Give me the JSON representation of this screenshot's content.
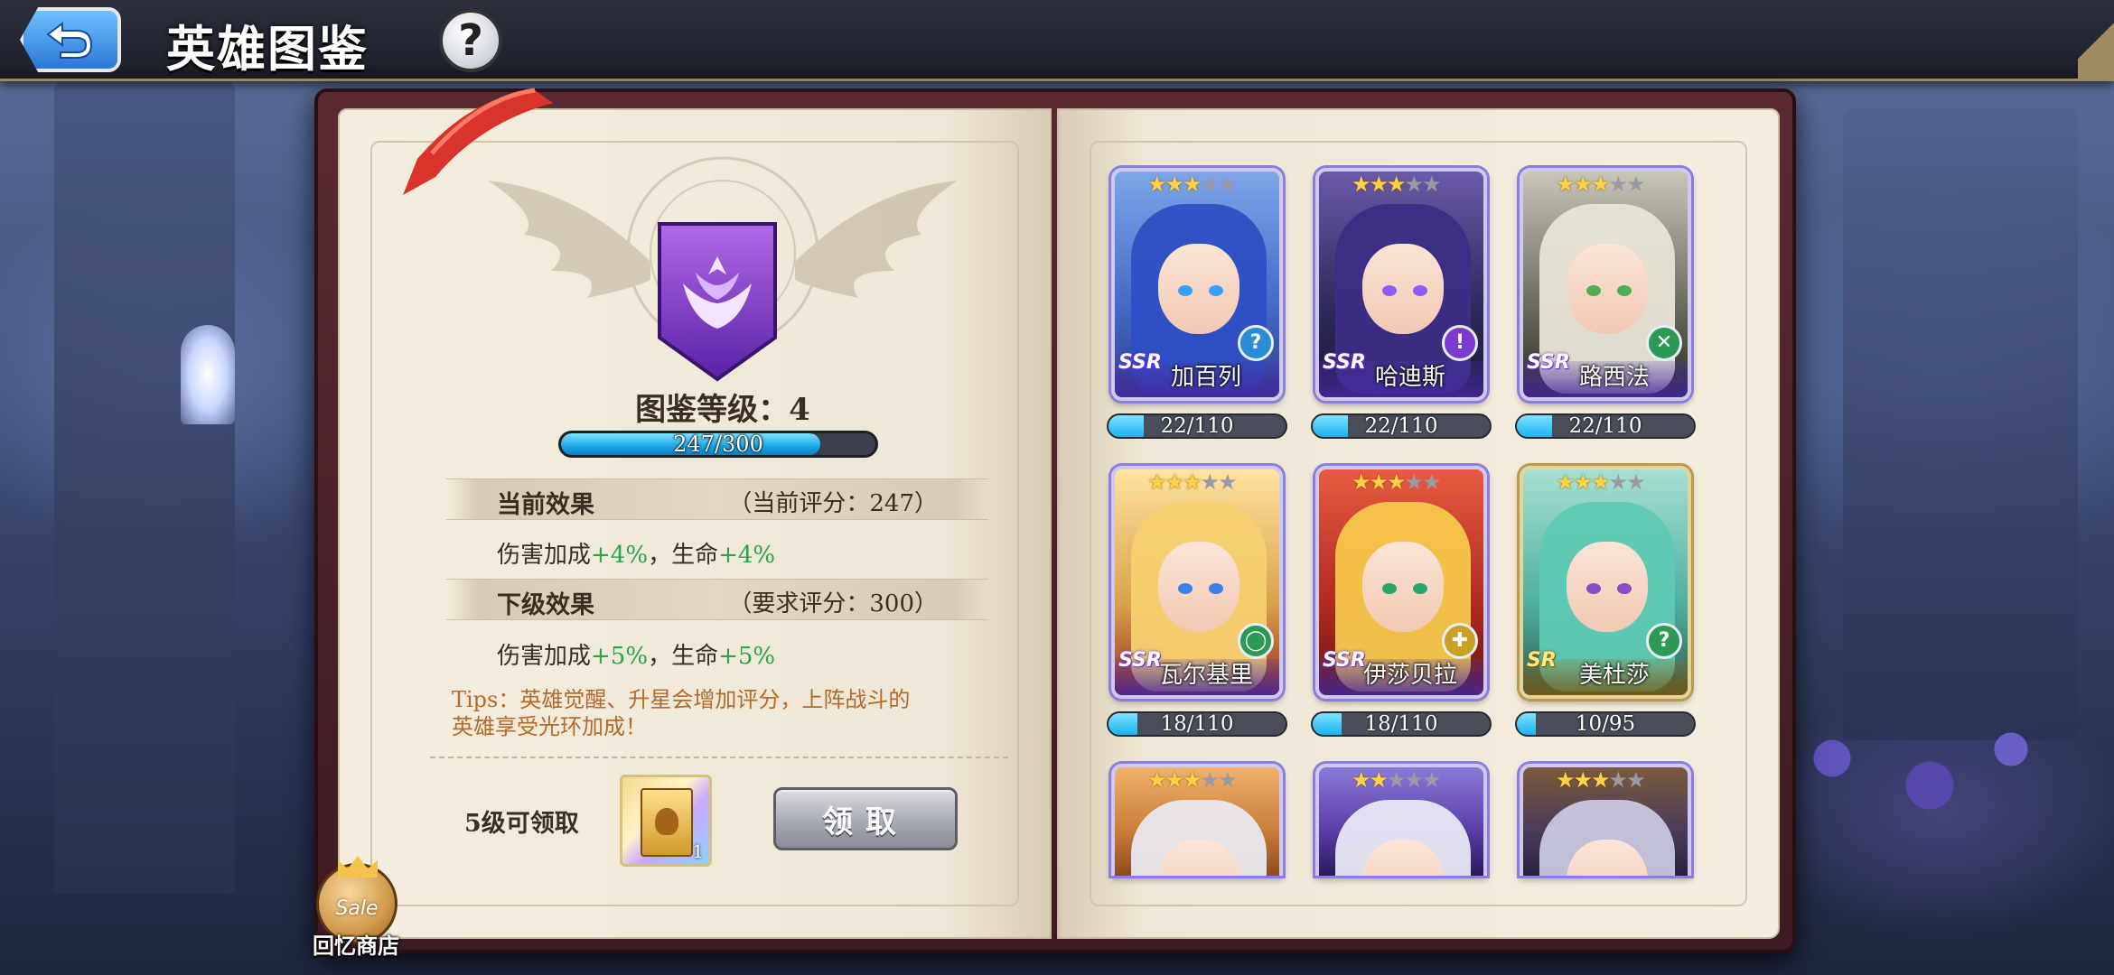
{
  "header": {
    "title": "英雄图鉴",
    "help_symbol": "?"
  },
  "collection": {
    "level_label": "图鉴等级：4",
    "exp_current": 247,
    "exp_max": 300,
    "exp_text": "247/300"
  },
  "current_effect": {
    "label": "当前效果",
    "score_text": "（当前评分：247）",
    "prefix1": "伤害加成",
    "value1": "+4%",
    "sep": "，",
    "prefix2": "生命",
    "value2": "+4%"
  },
  "next_effect": {
    "label": "下级效果",
    "score_text": "（要求评分：300）",
    "prefix1": "伤害加成",
    "value1": "+5%",
    "sep": "，",
    "prefix2": "生命",
    "value2": "+5%"
  },
  "tips": {
    "line1": "Tips：英雄觉醒、升星会增加评分，上阵战斗的",
    "line2": "英雄享受光环加成！"
  },
  "reward": {
    "unlock_text": "5级可领取",
    "quantity": "1",
    "claim_label": "领取"
  },
  "shop": {
    "sale_text": "Sale",
    "label": "回忆商店"
  },
  "heroes": [
    {
      "name": "加百列",
      "rarity": "SSR",
      "stars": 3,
      "max_stars": 5,
      "progress_text": "22/110",
      "current": 22,
      "max": 110,
      "class_icon": "question-class-icon",
      "class_symbol": "?",
      "class_color": "#2b8bd6"
    },
    {
      "name": "哈迪斯",
      "rarity": "SSR",
      "stars": 3,
      "max_stars": 5,
      "progress_text": "22/110",
      "current": 22,
      "max": 110,
      "class_icon": "exclaim-class-icon",
      "class_symbol": "!",
      "class_color": "#7b3bd1"
    },
    {
      "name": "路西法",
      "rarity": "SSR",
      "stars": 3,
      "max_stars": 5,
      "progress_text": "22/110",
      "current": 22,
      "max": 110,
      "class_icon": "swords-class-icon",
      "class_symbol": "✕",
      "class_color": "#2c9a55"
    },
    {
      "name": "瓦尔基里",
      "rarity": "SSR",
      "stars": 3,
      "max_stars": 5,
      "progress_text": "18/110",
      "current": 18,
      "max": 110,
      "class_icon": "shield-class-icon",
      "class_symbol": "◯",
      "class_color": "#2c9a55"
    },
    {
      "name": "伊莎贝拉",
      "rarity": "SSR",
      "stars": 3,
      "max_stars": 5,
      "progress_text": "18/110",
      "current": 18,
      "max": 110,
      "class_icon": "cross-class-icon",
      "class_symbol": "✚",
      "class_color": "#c9a022"
    },
    {
      "name": "美杜莎",
      "rarity": "SR",
      "stars": 3,
      "max_stars": 5,
      "progress_text": "10/95",
      "current": 10,
      "max": 95,
      "class_icon": "question-class-icon",
      "class_symbol": "?",
      "class_color": "#2c9a55"
    },
    {
      "name": "",
      "rarity": "",
      "stars": 3,
      "max_stars": 5,
      "progress_text": "",
      "current": 0,
      "max": 0,
      "class_icon": "",
      "class_symbol": "",
      "class_color": ""
    },
    {
      "name": "",
      "rarity": "",
      "stars": 2,
      "max_stars": 5,
      "progress_text": "",
      "current": 0,
      "max": 0,
      "class_icon": "",
      "class_symbol": "",
      "class_color": ""
    },
    {
      "name": "",
      "rarity": "",
      "stars": 3,
      "max_stars": 5,
      "progress_text": "",
      "current": 0,
      "max": 0,
      "class_icon": "",
      "class_symbol": "",
      "class_color": ""
    }
  ],
  "colors": {
    "accent_blue": "#19a9e8",
    "effect_green": "#27a54a",
    "tips_orange": "#b46a2a",
    "star_gold": "#ffd24a"
  }
}
